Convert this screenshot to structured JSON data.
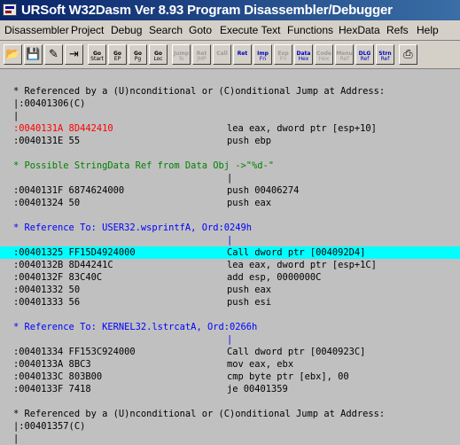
{
  "window": {
    "title": "URSoft W32Dasm Ver 8.93 Program Disassembler/Debugger"
  },
  "menu": [
    "Disassembler",
    "Project",
    "Debug",
    "Search",
    "Goto",
    "Execute Text",
    "Functions",
    "HexData",
    "Refs",
    "Help"
  ],
  "toolbar": {
    "buttons": [
      {
        "id": "open",
        "icon": "open-file-icon",
        "label": "",
        "sub": "",
        "state": "enabled"
      },
      {
        "id": "save",
        "icon": "save-file-icon",
        "label": "",
        "sub": "",
        "state": "enabled"
      },
      {
        "id": "pen",
        "icon": "pen-icon",
        "label": "",
        "sub": "",
        "state": "enabled"
      },
      {
        "id": "jump",
        "icon": "jump-arrow-icon",
        "label": "",
        "sub": "",
        "state": "enabled"
      },
      {
        "id": "goto-code-start",
        "icon": "goto-code-start-icon",
        "label": "Go",
        "sub": "Start",
        "state": "enabled"
      },
      {
        "id": "goto-entry-point",
        "icon": "goto-entry-point-icon",
        "label": "Go",
        "sub": "EP",
        "state": "enabled"
      },
      {
        "id": "goto-page",
        "icon": "goto-page-icon",
        "label": "Go",
        "sub": "Pg",
        "state": "enabled"
      },
      {
        "id": "goto-location",
        "icon": "goto-location-icon",
        "label": "Go",
        "sub": "Loc",
        "state": "enabled"
      },
      {
        "id": "jump-to",
        "icon": "jump-to-icon",
        "label": "Jump",
        "sub": "To",
        "state": "disabled"
      },
      {
        "id": "ret-jmp",
        "icon": "return-jump-icon",
        "label": "Ret",
        "sub": "JMP",
        "state": "disabled"
      },
      {
        "id": "call",
        "icon": "call-icon",
        "label": "Call",
        "sub": "",
        "state": "disabled"
      },
      {
        "id": "ret",
        "icon": "return-icon",
        "label": "Ret",
        "sub": "",
        "state": "enabled-blue"
      },
      {
        "id": "imp-fn",
        "icon": "imports-icon",
        "label": "Imp",
        "sub": "Fn",
        "state": "enabled-blue"
      },
      {
        "id": "exp-fn",
        "icon": "exports-icon",
        "label": "Exp",
        "sub": "Fn",
        "state": "disabled"
      },
      {
        "id": "data-hex",
        "icon": "data-hex-icon",
        "label": "Data",
        "sub": "Hex",
        "state": "enabled-blue"
      },
      {
        "id": "code-hex",
        "icon": "code-hex-icon",
        "label": "Code",
        "sub": "Hex",
        "state": "disabled"
      },
      {
        "id": "menu-ref",
        "icon": "menu-ref-icon",
        "label": "Menu",
        "sub": "Ref",
        "state": "disabled"
      },
      {
        "id": "dlg-ref",
        "icon": "dialog-ref-icon",
        "label": "DLG",
        "sub": "Ref",
        "state": "enabled-blue"
      },
      {
        "id": "str-ref",
        "icon": "string-ref-icon",
        "label": "Strn",
        "sub": "Ref",
        "state": "enabled-blue"
      },
      {
        "id": "print",
        "icon": "print-icon",
        "label": "",
        "sub": "",
        "state": "enabled"
      }
    ]
  },
  "colors": {
    "highlight": "#00ffff",
    "address_red": "#ff0000",
    "string_ref": "#008000",
    "import_ref": "#0000ff"
  },
  "listing": [
    {
      "type": "blank",
      "text": ""
    },
    {
      "type": "comment",
      "text": "* Referenced by a (U)nconditional or (C)onditional Jump at Address:"
    },
    {
      "type": "comment",
      "text": "|:00401306(C)"
    },
    {
      "type": "comment",
      "text": "|"
    },
    {
      "type": "code",
      "addr": ":0040131A 8D442410",
      "op": "lea eax, dword ptr [esp+10]",
      "color": "red"
    },
    {
      "type": "code",
      "addr": ":0040131E 55",
      "op": "push ebp"
    },
    {
      "type": "blank",
      "text": ""
    },
    {
      "type": "strref",
      "text": "* Possible StringData Ref from Data Obj ->\"%d-\""
    },
    {
      "type": "pipe",
      "text": "|"
    },
    {
      "type": "code",
      "addr": ":0040131F 6874624000",
      "op": "push 00406274"
    },
    {
      "type": "code",
      "addr": ":00401324 50",
      "op": "push eax"
    },
    {
      "type": "blank",
      "text": ""
    },
    {
      "type": "ref",
      "text": "* Reference To: USER32.wsprintfA, Ord:0249h"
    },
    {
      "type": "pipe-blue",
      "text": "|"
    },
    {
      "type": "code",
      "addr": ":00401325 FF15D4924000",
      "op": "Call dword ptr [004092D4]",
      "highlight": true
    },
    {
      "type": "code",
      "addr": ":0040132B 8D44241C",
      "op": "lea eax, dword ptr [esp+1C]"
    },
    {
      "type": "code",
      "addr": ":0040132F 83C40C",
      "op": "add esp, 0000000C"
    },
    {
      "type": "code",
      "addr": ":00401332 50",
      "op": "push eax"
    },
    {
      "type": "code",
      "addr": ":00401333 56",
      "op": "push esi"
    },
    {
      "type": "blank",
      "text": ""
    },
    {
      "type": "ref",
      "text": "* Reference To: KERNEL32.lstrcatA, Ord:0266h"
    },
    {
      "type": "pipe-blue",
      "text": "|"
    },
    {
      "type": "code",
      "addr": ":00401334 FF153C924000",
      "op": "Call dword ptr [0040923C]"
    },
    {
      "type": "code",
      "addr": ":0040133A 8BC3",
      "op": "mov eax, ebx"
    },
    {
      "type": "code",
      "addr": ":0040133C 803B00",
      "op": "cmp byte ptr [ebx], 00"
    },
    {
      "type": "code",
      "addr": ":0040133F 7418",
      "op": "je 00401359"
    },
    {
      "type": "blank",
      "text": ""
    },
    {
      "type": "comment",
      "text": "* Referenced by a (U)nconditional or (C)onditional Jump at Address:"
    },
    {
      "type": "comment",
      "text": "|:00401357(C)"
    },
    {
      "type": "comment",
      "text": "|"
    }
  ]
}
